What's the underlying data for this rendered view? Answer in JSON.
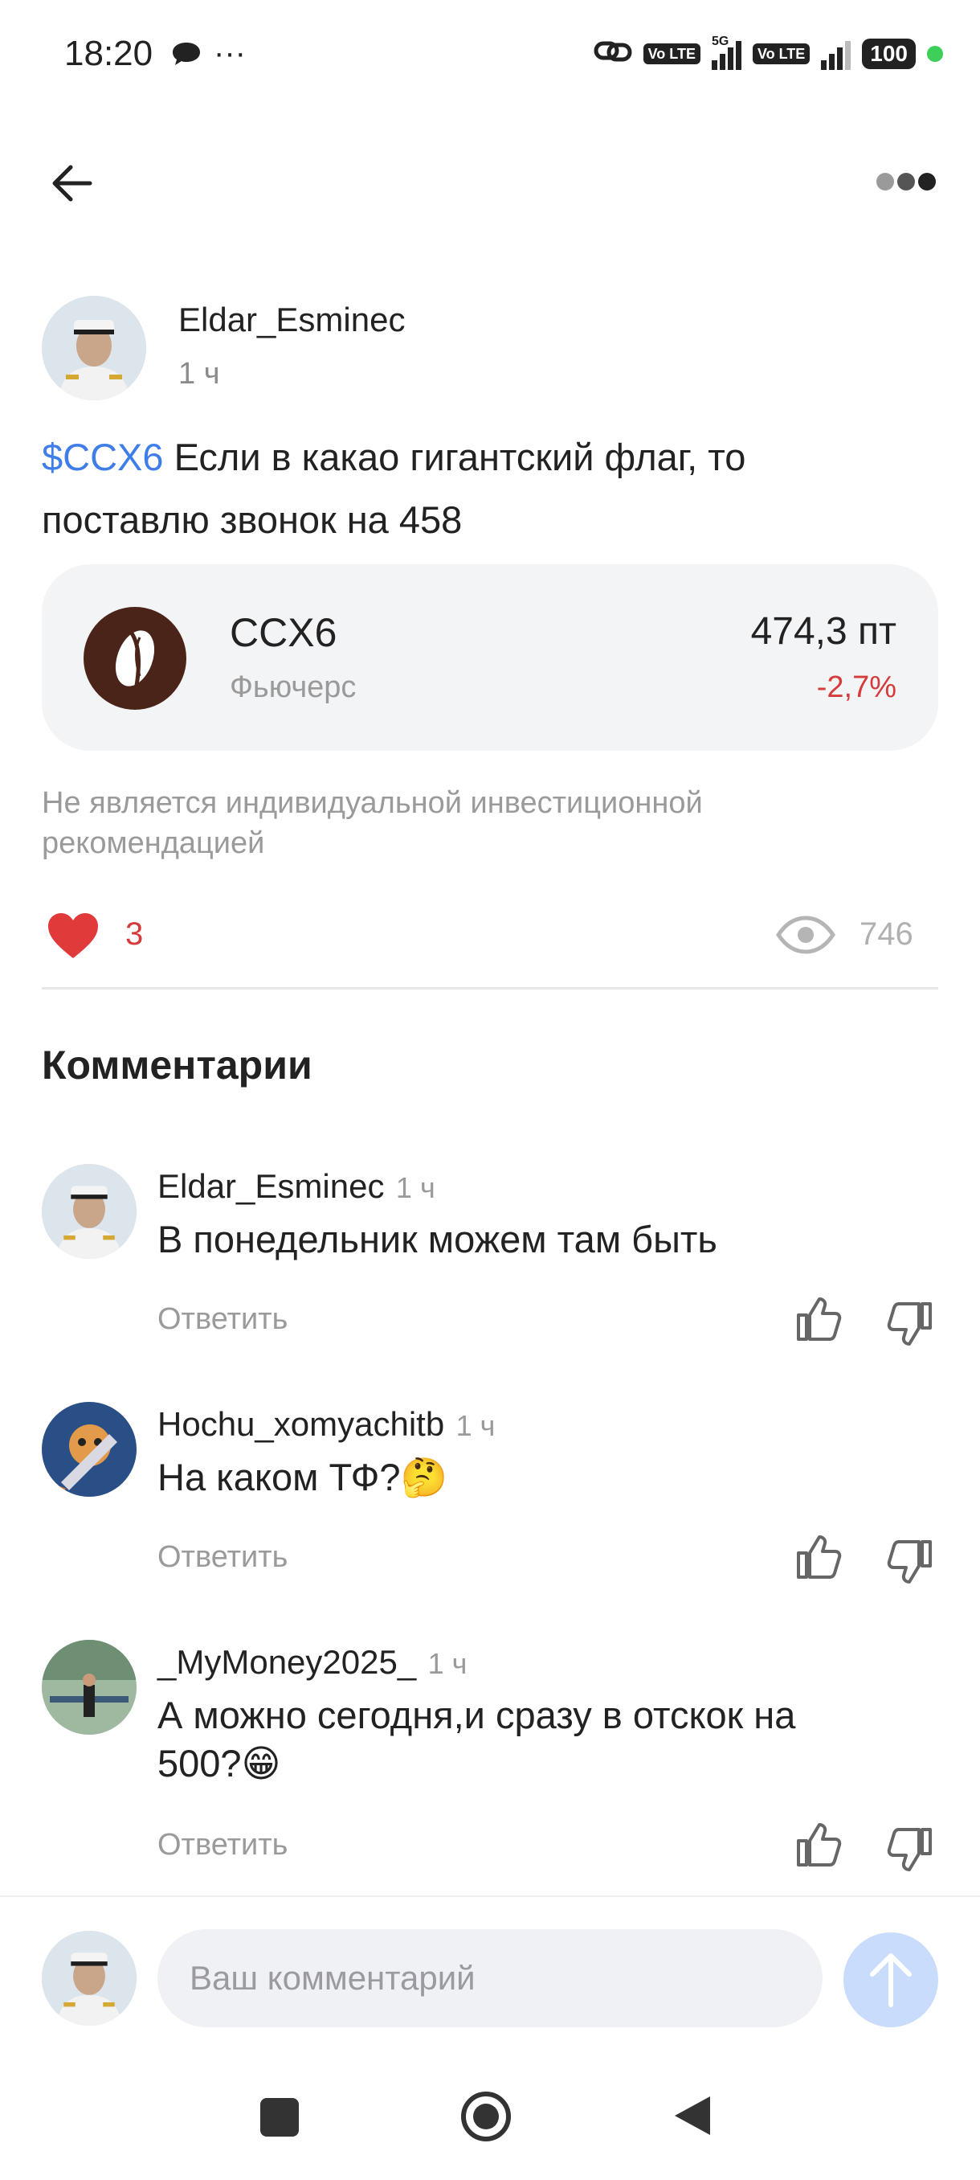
{
  "status_bar": {
    "time": "18:20",
    "icons": [
      "chat-bubble-icon",
      "more-dots-icon",
      "link-icon",
      "volte-icon",
      "signal-5g-icon",
      "volte-icon",
      "signal-icon"
    ],
    "network": "5G",
    "volte": "Vo LTE",
    "battery": "100",
    "more": "···"
  },
  "post": {
    "author": "Eldar_Esminec",
    "time": "1 ч",
    "ticker_tag": "$CCX6",
    "text_line1": " Если в какао гигантский флаг, то",
    "text_line2": "поставлю звонок на 458",
    "instrument": {
      "name": "CCX6",
      "type": "Фьючерс",
      "price": "474,3 пт",
      "change": "-2,7%"
    },
    "disclaimer": "Не является индивидуальной инвестиционной рекомендацией",
    "likes": "3",
    "views": "746"
  },
  "comments_title": "Комментарии",
  "comments": [
    {
      "author": "Eldar_Esminec",
      "time": "1 ч",
      "text": "В понедельник можем там быть",
      "reply_label": "Ответить"
    },
    {
      "author": "Hochu_xomyachitb",
      "time": "1 ч",
      "text": "На каком ТФ?🤔",
      "reply_label": "Ответить"
    },
    {
      "author": "_MyMoney2025_",
      "time": "1 ч",
      "text_line1": "А можно сегодня,и сразу в отскок на",
      "text_line2": "500?😁",
      "reply_label": "Ответить"
    }
  ],
  "comment_input": {
    "placeholder": "Ваш комментарий"
  },
  "colors": {
    "accent_link": "#3f7ee8",
    "negative": "#d63b3b",
    "send_button": "#c9dcfb"
  }
}
